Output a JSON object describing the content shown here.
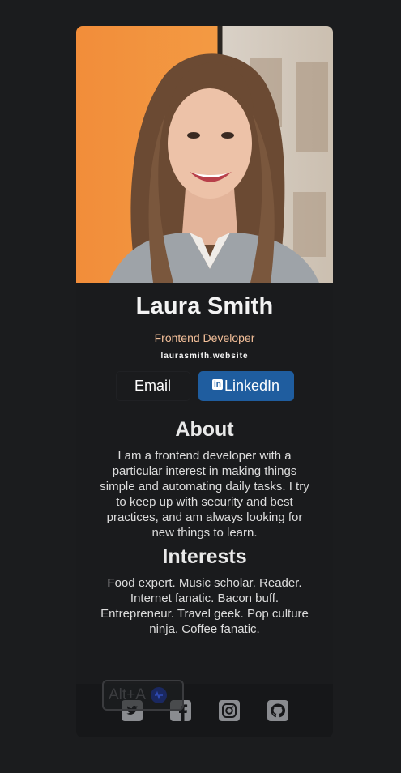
{
  "profile": {
    "name": "Laura Smith",
    "title": "Frontend Developer",
    "website": "laurasmith.website",
    "photo_icon": "portrait-photo"
  },
  "buttons": {
    "email_label": "Email",
    "linkedin_label": "LinkedIn",
    "linkedin_icon_letters": "in"
  },
  "about": {
    "heading": "About",
    "text": "I am a frontend developer with a particular interest in making things simple and automating daily tasks. I try to keep up with security and best practices, and am always looking for new things to learn."
  },
  "interests": {
    "heading": "Interests",
    "text": "Food expert. Music scholar. Reader. Internet fanatic. Bacon buff. Entrepreneur. Travel geek. Pop culture ninja. Coffee fanatic."
  },
  "footer": {
    "icons": [
      "twitter-icon",
      "facebook-icon",
      "instagram-icon",
      "github-icon"
    ]
  },
  "overlay": {
    "shortcut": "Alt+A"
  },
  "colors": {
    "background": "#1b1c1e",
    "accent_title": "#f3bf99",
    "linkedin": "#1f5d9f",
    "footer_icon": "#8a8c90"
  }
}
